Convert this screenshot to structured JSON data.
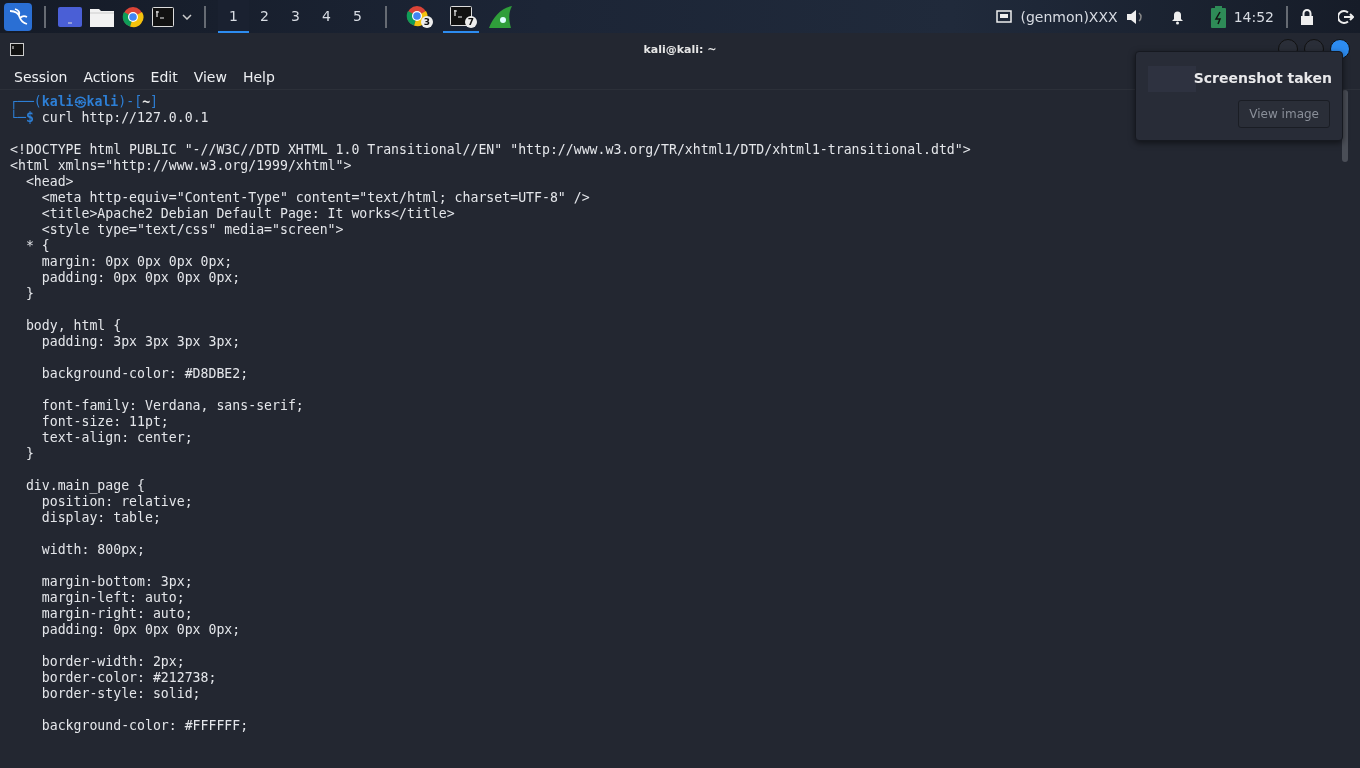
{
  "taskbar": {
    "workspaces": [
      {
        "label": "1",
        "selected": true
      },
      {
        "label": "2",
        "selected": false
      },
      {
        "label": "3",
        "selected": false
      },
      {
        "label": "4",
        "selected": false
      },
      {
        "label": "5",
        "selected": false
      }
    ],
    "tasks": [
      {
        "kind": "browser",
        "badge": "3",
        "selected": false
      },
      {
        "kind": "terminal",
        "badge": "7",
        "selected": true
      }
    ],
    "genmon": "(genmon)XXX",
    "clock": "14:52"
  },
  "window": {
    "title": "kali@kali: ~",
    "menu": [
      "Session",
      "Actions",
      "Edit",
      "View",
      "Help"
    ]
  },
  "terminal": {
    "prompt_line": [
      {
        "text": "┌──(",
        "kind": "frame"
      },
      {
        "text": "kali㉿kali",
        "kind": "user"
      },
      {
        "text": ")-[",
        "kind": "frame"
      },
      {
        "text": "~",
        "kind": "path"
      },
      {
        "text": "]",
        "kind": "frame"
      }
    ],
    "command_line": [
      {
        "text": "└─",
        "kind": "frame"
      },
      {
        "text": "$",
        "kind": "user"
      },
      {
        "text": " curl http://127.0.0.1",
        "kind": "plain"
      }
    ],
    "output_blocks": [
      [
        "<!DOCTYPE html PUBLIC \"-//W3C//DTD XHTML 1.0 Transitional//EN\" \"http://www.w3.org/TR/xhtml1/DTD/xhtml1-transitional.dtd\">",
        "<html xmlns=\"http://www.w3.org/1999/xhtml\">",
        "  <head>",
        "    <meta http-equiv=\"Content-Type\" content=\"text/html; charset=UTF-8\" />",
        "    <title>Apache2 Debian Default Page: It works</title>",
        "    <style type=\"text/css\" media=\"screen\">",
        "  * {",
        "    margin: 0px 0px 0px 0px;",
        "    padding: 0px 0px 0px 0px;",
        "  }"
      ],
      [
        "  body, html {",
        "    padding: 3px 3px 3px 3px;"
      ],
      [
        "    background-color: #D8DBE2;"
      ],
      [
        "    font-family: Verdana, sans-serif;",
        "    font-size: 11pt;",
        "    text-align: center;",
        "  }"
      ],
      [
        "  div.main_page {",
        "    position: relative;",
        "    display: table;"
      ],
      [
        "    width: 800px;"
      ],
      [
        "    margin-bottom: 3px;",
        "    margin-left: auto;",
        "    margin-right: auto;",
        "    padding: 0px 0px 0px 0px;"
      ],
      [
        "    border-width: 2px;",
        "    border-color: #212738;",
        "    border-style: solid;"
      ],
      [
        "    background-color: #FFFFFF;"
      ]
    ]
  },
  "notification": {
    "title": "Screenshot taken",
    "button": "View image"
  }
}
